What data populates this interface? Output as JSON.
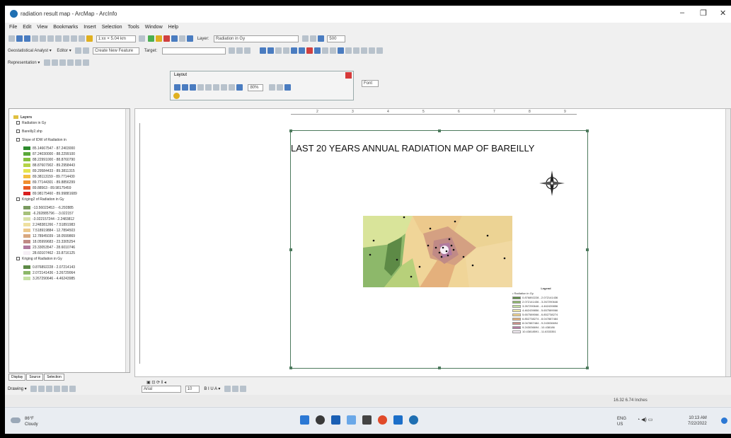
{
  "window": {
    "title": "radiation result map - ArcMap - ArcInfo",
    "minimize": "–",
    "restore": "❐",
    "close": "✕"
  },
  "menu": [
    "File",
    "Edit",
    "View",
    "Bookmarks",
    "Insert",
    "Selection",
    "Tools",
    "Window",
    "Help"
  ],
  "toolbar1": {
    "scale": "1:xx × 5.04 km",
    "layer_label": "Layer:",
    "layer_value": "Radiation in Gy",
    "zoom_value": "500"
  },
  "toolbar2": {
    "geostat": "Geostatistical Analyst ▾",
    "editor": "Editor ▾",
    "create_features": "Create New Feature",
    "target": "Target:"
  },
  "toolbar3": {
    "representation": "Representation ▾"
  },
  "layout_toolbar": {
    "title": "Layout",
    "zoom_value": "80%",
    "font_field": "Font"
  },
  "toc": {
    "root": "Layers",
    "items": [
      {
        "type": "layer",
        "label": "Radiation in Gy"
      },
      {
        "type": "layer",
        "label": "Bareilly2.shp"
      },
      {
        "type": "layer",
        "label": "Slope of IDW of Radiation in"
      },
      {
        "type": "entry",
        "label": "85.14667547 - 87.2403000",
        "color": "#2e8b2e"
      },
      {
        "type": "entry",
        "label": "87.24030000 - 88.2299100",
        "color": "#5aa83a"
      },
      {
        "type": "entry",
        "label": "88.22991000 - 88.8760790",
        "color": "#86c040"
      },
      {
        "type": "entry",
        "label": "88.87607902 - 89.2958443",
        "color": "#b5d348"
      },
      {
        "type": "entry",
        "label": "89.29584433 - 89.3811315",
        "color": "#e4e34e"
      },
      {
        "type": "entry",
        "label": "89.38113159 - 89.7714430",
        "color": "#f2c040"
      },
      {
        "type": "entry",
        "label": "89.77144301 - 89.8856299",
        "color": "#f09030"
      },
      {
        "type": "entry",
        "label": "89.88563 - 89.98175459",
        "color": "#e85c25"
      },
      {
        "type": "entry",
        "label": "89.98175460 - 89.99881689",
        "color": "#d92020"
      },
      {
        "type": "layer",
        "label": "Kriging2 of Radiation in Gy"
      },
      {
        "type": "entry",
        "label": "-13.56023453 - -6.292885",
        "color": "#7a9a60"
      },
      {
        "type": "entry",
        "label": "-6.292885796 - -3.022157",
        "color": "#a6c07a"
      },
      {
        "type": "entry",
        "label": "-3.022157244 - 2.2483812",
        "color": "#d8e0a8"
      },
      {
        "type": "entry",
        "label": "2.248381266 - 7.51891983",
        "color": "#efe0a0"
      },
      {
        "type": "entry",
        "label": "7.518919884 - 12.7894503",
        "color": "#ecc98c"
      },
      {
        "type": "entry",
        "label": "12.78945039 - 18.0599869",
        "color": "#d8a880"
      },
      {
        "type": "entry",
        "label": "18.05999683 - 23.3305254",
        "color": "#c08a86"
      },
      {
        "type": "entry",
        "label": "23.33053547 - 28.6010746",
        "color": "#b07aa0"
      },
      {
        "type": "entry",
        "label": "28.60107462 - 33.8716125",
        "color": "#f4eef4"
      },
      {
        "type": "layer",
        "label": "Kriging of Radiation in Gy"
      },
      {
        "type": "entry",
        "label": "0.876892228 - 2.07214143",
        "color": "#5d8a46"
      },
      {
        "type": "entry",
        "label": "2.072141436 - 3.26729064",
        "color": "#8db86a"
      },
      {
        "type": "entry",
        "label": "3.267290646 - 4.46243985",
        "color": "#c6e0a4"
      }
    ]
  },
  "toc_tabs": [
    "Display",
    "Source",
    "Selection"
  ],
  "map": {
    "title": "LAST 20 YEARS ANNUAL RADIATION MAP OF BAREILLY",
    "ruler_ticks": [
      "2",
      "3",
      "4",
      "5",
      "6",
      "7",
      "8",
      "9"
    ],
    "legend": {
      "title": "Legend",
      "point_label": "Radiation in Gy",
      "entries": [
        {
          "label": "0.876892228 - 2.072141436",
          "color": "#5d8a46"
        },
        {
          "label": "2.072141436 - 3.267290646",
          "color": "#8db86a"
        },
        {
          "label": "3.267290646 - 4.462439856",
          "color": "#c6e0a4"
        },
        {
          "label": "4.462439856 - 5.657589066",
          "color": "#eee6a8"
        },
        {
          "label": "5.657589066 - 6.852738274",
          "color": "#f1d28c"
        },
        {
          "label": "6.852738274 - 8.047887484",
          "color": "#e4b07c"
        },
        {
          "label": "8.047887484 - 9.243036694",
          "color": "#c9908a"
        },
        {
          "label": "9.243036694 - 10.438186",
          "color": "#b57aa2"
        },
        {
          "label": "10.43818591 - 11.6333351",
          "color": "#f6eef6"
        }
      ]
    }
  },
  "view_controls": "▣ ⊡ ⟳ ‖ ◂",
  "drawing": {
    "label": "Drawing ▾",
    "font": "Arial",
    "size": "10",
    "style": "B I U A ▾"
  },
  "status": {
    "coords": "16.32  6.74 Inches"
  },
  "taskbar": {
    "weather_temp": "86°F",
    "weather_desc": "Cloudy",
    "lang1": "ENG",
    "lang2": "US",
    "time": "10:13 AM",
    "date": "7/22/2022"
  }
}
